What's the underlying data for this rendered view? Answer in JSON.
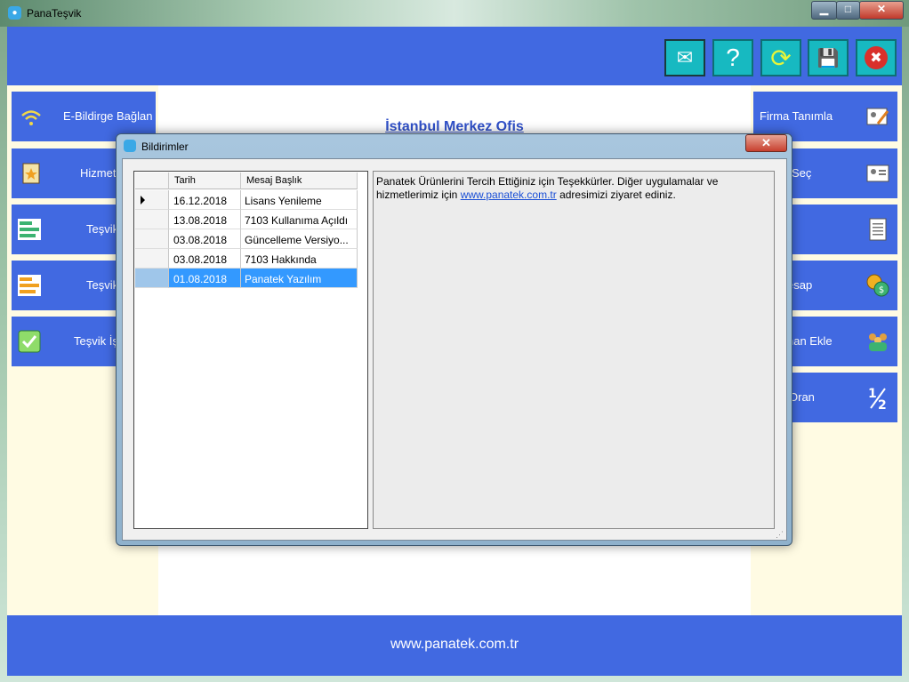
{
  "window": {
    "title": "PanaTeşvik",
    "minimize": "▁",
    "maximize": "□",
    "close": "✕"
  },
  "toolbar": {
    "mail_icon": "envelope-icon",
    "help_icon": "question-icon",
    "refresh_icon": "refresh-icon",
    "save_icon": "floppy-icon",
    "close_icon": "close-icon",
    "glyph_mail": "✉",
    "glyph_help": "?",
    "glyph_refresh": "⟳",
    "glyph_save": "💾",
    "glyph_close": "✖"
  },
  "office_title": "İstanbul Merkez Ofis",
  "left_nav": [
    {
      "label": "E-Bildirge Bağlan"
    },
    {
      "label": "Hizmet"
    },
    {
      "label": "Teşvik"
    },
    {
      "label": "Teşvik"
    },
    {
      "label": "Teşvik İş"
    }
  ],
  "right_nav": [
    {
      "label": "Firma Tanımla"
    },
    {
      "label": "Seç"
    },
    {
      "label": ""
    },
    {
      "label": "esap"
    },
    {
      "label": "nan Ekle"
    },
    {
      "label": "Oran"
    }
  ],
  "dialog": {
    "title": "Bildirimler",
    "close": "✕",
    "columns": [
      "Tarih",
      "Mesaj Başlık"
    ],
    "rows": [
      {
        "date": "16.12.2018",
        "title": "Lisans Yenileme"
      },
      {
        "date": "13.08.2018",
        "title": "7103 Kullanıma Açıldı"
      },
      {
        "date": "03.08.2018",
        "title": "Güncelleme Versiyo..."
      },
      {
        "date": "03.08.2018",
        "title": "7103 Hakkında"
      },
      {
        "date": "01.08.2018",
        "title": "Panatek Yazılım"
      }
    ],
    "message_part1": "Panatek Ürünlerini Tercih Ettiğiniz için Teşekkürler. Diğer uygulamalar ve hizmetlerimiz için ",
    "message_link": "www.panatek.com.tr",
    "message_part2": " adresimizi ziyaret ediniz."
  },
  "footer": "www.panatek.com.tr"
}
